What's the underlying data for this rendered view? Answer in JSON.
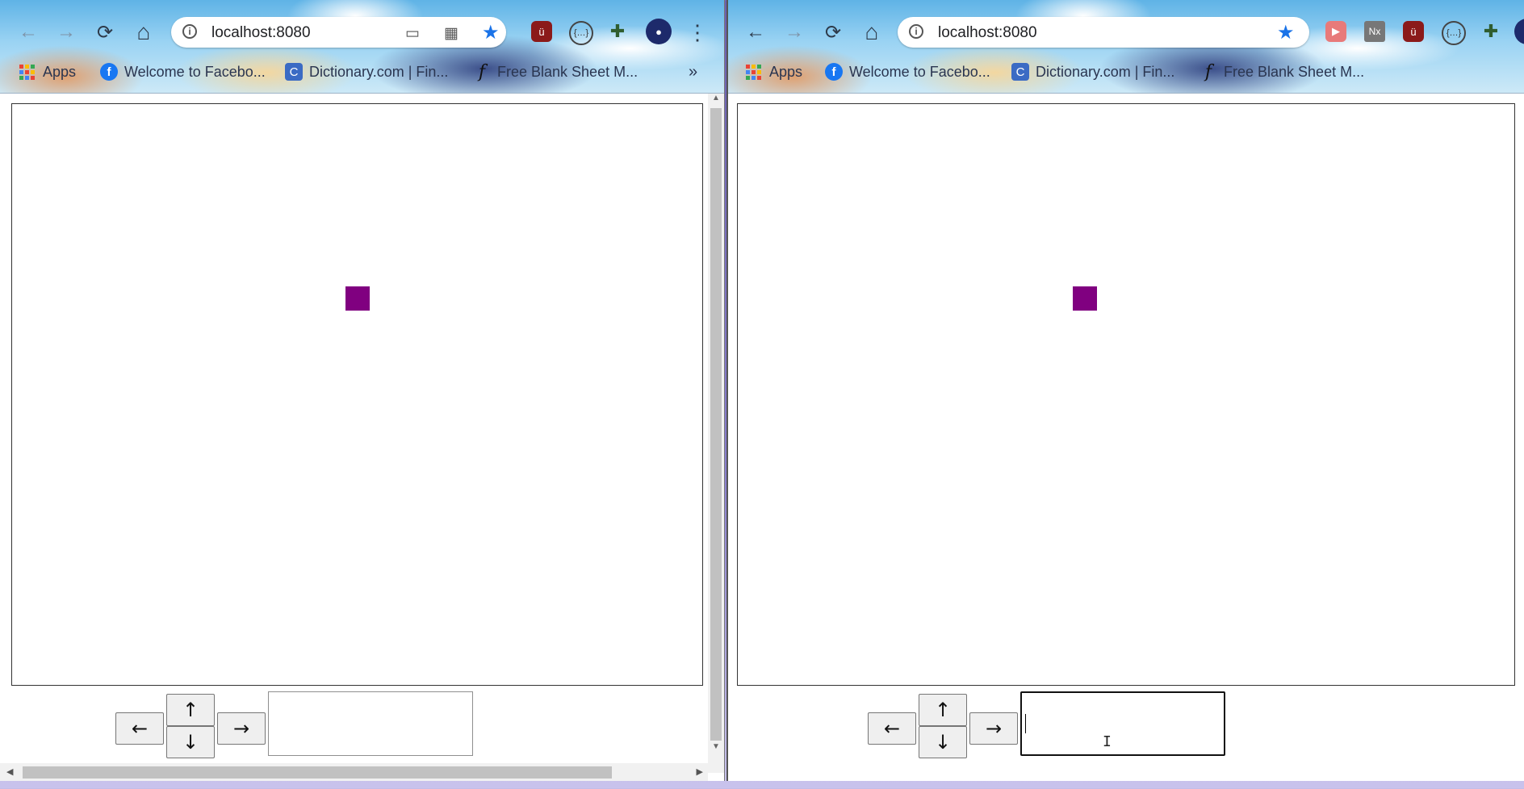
{
  "windows": [
    {
      "url": "localhost:8080",
      "bookmarks": {
        "apps": "Apps",
        "items": [
          "Welcome to Facebo...",
          "Dictionary.com | Fin...",
          "Free Blank Sheet M..."
        ],
        "overflow": "»"
      }
    },
    {
      "url": "localhost:8080",
      "bookmarks": {
        "apps": "Apps",
        "items": [
          "Welcome to Facebo...",
          "Dictionary.com | Fin...",
          "Free Blank Sheet M..."
        ]
      }
    }
  ],
  "controls": {
    "left": "←",
    "up": "↑",
    "down": "↓",
    "right": "→"
  },
  "icons": {
    "back": "←",
    "forward": "→",
    "reload": "⟳",
    "home": "⌂",
    "star": "★",
    "menu": "⋮"
  },
  "colors": {
    "player": "#800080"
  }
}
